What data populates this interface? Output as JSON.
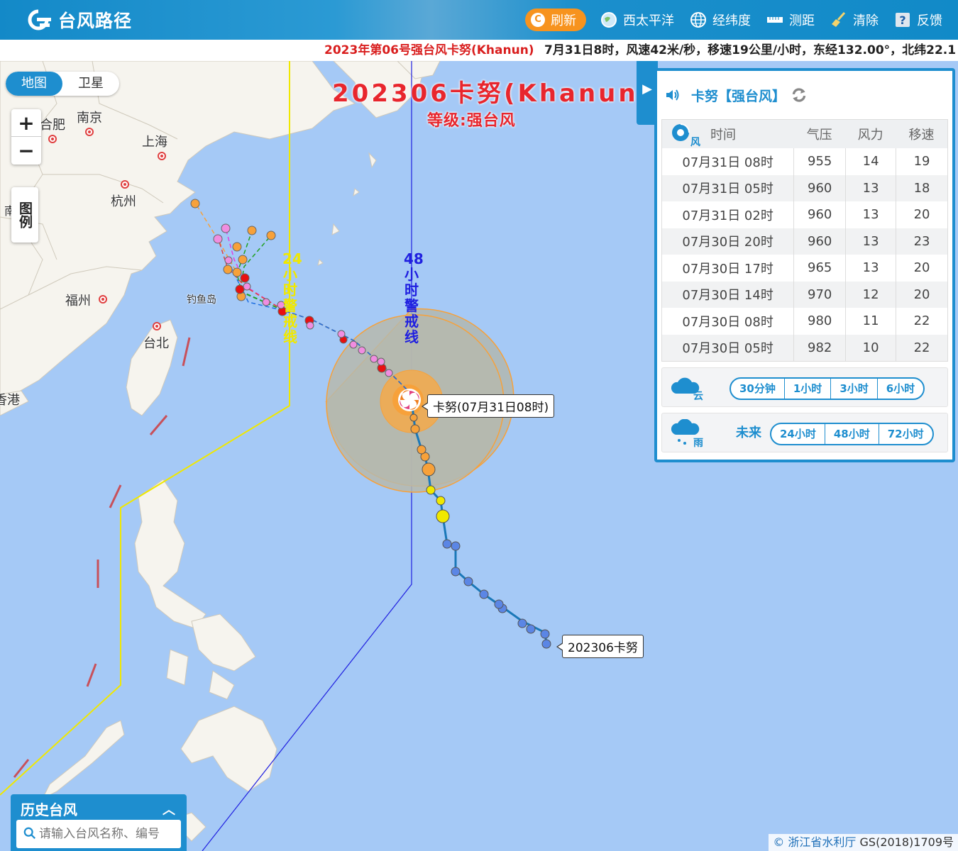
{
  "header": {
    "logo_text": "台风路径",
    "nav": {
      "refresh": "刷新",
      "west_pacific": "西太平洋",
      "latlon": "经纬度",
      "measure": "测距",
      "clear": "清除",
      "feedback": "反馈"
    }
  },
  "ticker": {
    "name": "2023年第06号强台风卡努(Khanun)",
    "detail": "7月31日8时，风速42米/秒，移速19公里/小时，东经132.00°，北纬22.1"
  },
  "map": {
    "maptype": {
      "map": "地图",
      "satellite": "卫星"
    },
    "zoom": {
      "in": "+",
      "out": "−"
    },
    "legend": "图例",
    "typhoon_title": "202306卡努(Khanun)",
    "typhoon_grade": "等级:强台风",
    "warning_24": "24小时警戒线",
    "warning_48": "48小时警戒线",
    "current_label": "卡努(07月31日08时)",
    "start_label": "202306卡努",
    "cities": {
      "hefei": "合肥",
      "nanjing": "南京",
      "shanghai": "上海",
      "hangzhou": "杭州",
      "fuzhou": "福州",
      "diaoyu": "钓鱼岛",
      "taipei": "台北",
      "hongkong_partial": "香港",
      "nanchang_partial": "南"
    }
  },
  "panel": {
    "name": "卡努",
    "grade": "【强台风】",
    "columns": {
      "time": "时间",
      "pressure": "气压",
      "wind": "风力",
      "speed": "移速"
    },
    "rows": [
      {
        "time": "07月31日 08时",
        "pressure": "955",
        "wind": "14",
        "speed": "19"
      },
      {
        "time": "07月31日 05时",
        "pressure": "960",
        "wind": "13",
        "speed": "18"
      },
      {
        "time": "07月31日 02时",
        "pressure": "960",
        "wind": "13",
        "speed": "20"
      },
      {
        "time": "07月30日 20时",
        "pressure": "960",
        "wind": "13",
        "speed": "23"
      },
      {
        "time": "07月30日 17时",
        "pressure": "965",
        "wind": "13",
        "speed": "20"
      },
      {
        "time": "07月30日 14时",
        "pressure": "970",
        "wind": "12",
        "speed": "20"
      },
      {
        "time": "07月30日 08时",
        "pressure": "980",
        "wind": "11",
        "speed": "22"
      },
      {
        "time": "07月30日 05时",
        "pressure": "982",
        "wind": "10",
        "speed": "22"
      }
    ],
    "cloud": {
      "label": "云",
      "options": [
        "30分钟",
        "1小时",
        "3小时",
        "6小时"
      ]
    },
    "rain": {
      "label": "雨",
      "future": "未来",
      "options": [
        "24小时",
        "48小时",
        "72小时"
      ]
    },
    "wind_label": "风"
  },
  "history": {
    "title": "历史台风",
    "placeholder": "请输入台风名称、编号"
  },
  "copyright": {
    "org": "© 浙江省水利厅",
    "license": "GS(2018)1709号"
  },
  "colors": {
    "accent": "#1e8ecf",
    "title_red": "#e8262d",
    "warning_24": "#f0e800",
    "warning_48": "#2020e0",
    "track_line": "#1a78b8",
    "tropical_storm": "#5b86e5",
    "severe_storm": "#f0e800",
    "typhoon": "#f7a13a",
    "strong_typhoon": "#f08de0",
    "super_typhoon": "#e81010"
  }
}
